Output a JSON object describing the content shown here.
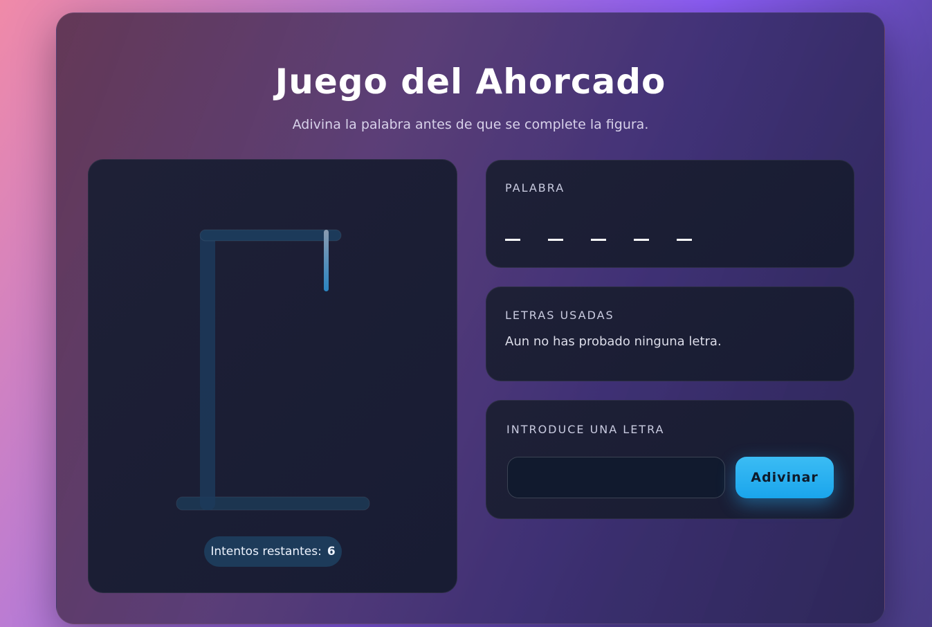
{
  "header": {
    "title": "Juego del Ahorcado",
    "subtitle": "Adivina la palabra antes de que se complete la figura."
  },
  "status": {
    "attempts_label": "Intentos restantes:",
    "attempts_value": "6"
  },
  "word": {
    "label": "PALABRA",
    "slots": [
      "_",
      "_",
      "_",
      "_",
      "_"
    ]
  },
  "used_letters": {
    "label": "LETRAS USADAS",
    "empty_text": "Aun no has probado ninguna letra."
  },
  "guess": {
    "label": "INTRODUCE UNA LETRA",
    "input_value": "",
    "input_placeholder": "",
    "button_label": "Adivinar"
  },
  "colors": {
    "accent": "#1aa5ec",
    "badge": "#1d3b5a",
    "gallows": "#1c3a5a"
  }
}
